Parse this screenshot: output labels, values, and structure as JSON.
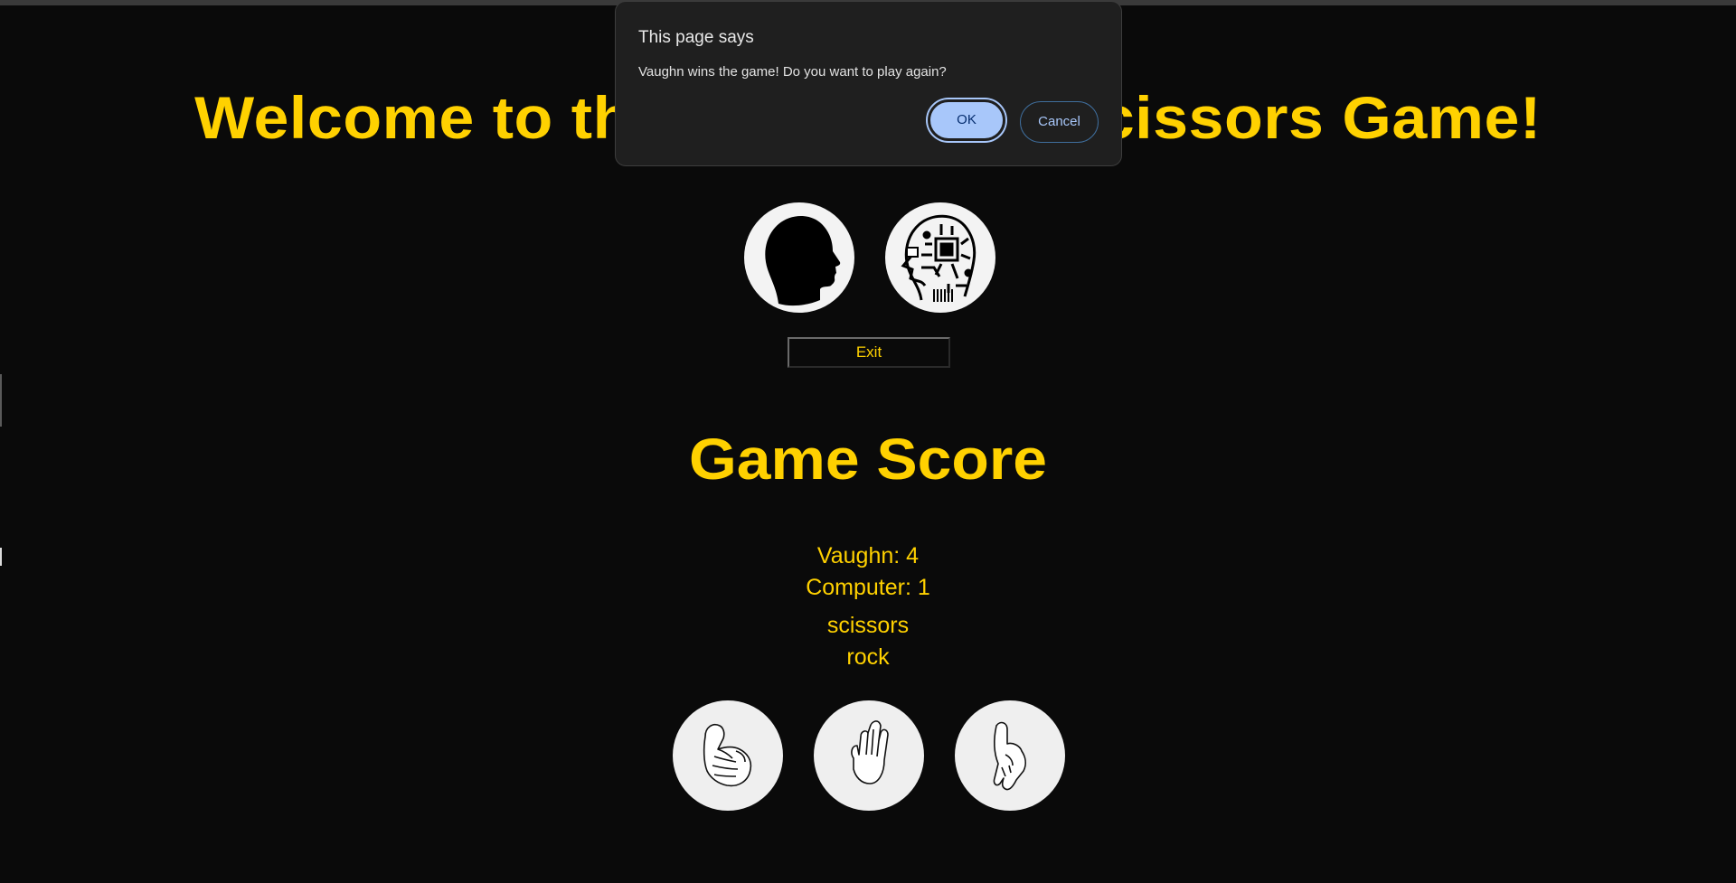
{
  "page": {
    "title": "Welcome to the Rock Paper Scissors Game!",
    "exit_label": "Exit",
    "score_title": "Game Score",
    "player_score": "Vaughn: 4",
    "computer_score": "Computer: 1",
    "player_choice": "scissors",
    "computer_choice": "rock"
  },
  "players": {
    "human_icon": "human-head-silhouette-icon",
    "computer_icon": "robot-circuit-head-icon"
  },
  "choices": [
    {
      "name": "rock",
      "icon": "fist-hand-icon"
    },
    {
      "name": "paper",
      "icon": "open-hand-icon"
    },
    {
      "name": "scissors",
      "icon": "pointing-hand-icon"
    }
  ],
  "dialog": {
    "title": "This page says",
    "message": "Vaughn wins the game! Do you want to play again?",
    "ok_label": "OK",
    "cancel_label": "Cancel"
  },
  "colors": {
    "background": "#0a0a0a",
    "accent": "#ffd100",
    "dialog_bg": "#1f1f1f",
    "ok_bg": "#a8c7fa"
  }
}
